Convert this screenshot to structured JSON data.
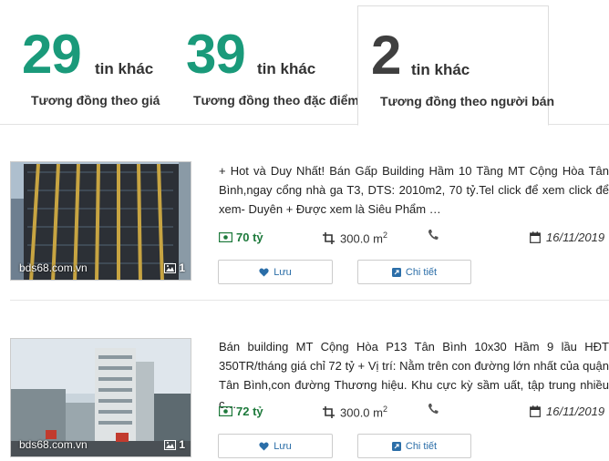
{
  "tabs": [
    {
      "count": "29",
      "more": "tin khác",
      "label": "Tương đồng theo giá"
    },
    {
      "count": "39",
      "more": "tin khác",
      "label": "Tương đồng theo đặc điểm"
    },
    {
      "count": "2",
      "more": "tin khác",
      "label": "Tương đồng theo người bán"
    }
  ],
  "listings": [
    {
      "description": "+ Hot và Duy Nhất! Bán Gấp Building Hầm 10 Tầng MT Cộng Hòa Tân Bình,ngay cổng nhà ga T3, DTS: 2010m2, 70 tỷ.Tel click để xem                click để xem- Duyên + Được xem là Siêu Phẩm …",
      "price": "70 tỷ",
      "area": "300.0 m",
      "area_sup": "2",
      "date": "16/11/2019",
      "site": "bds68.com.vn",
      "photo_count": "1",
      "save_label": "Lưu",
      "detail_label": "Chi tiết"
    },
    {
      "description": "Bán building MT Cộng Hòa P13 Tân Bình 10x30 Hầm 9 lầu HĐT 350TR/tháng giá chỉ 72 tỷ + Vị trí: Nằm trên con đường lớn nhất của quận Tân Bình,con đường Thương hiệu. Khu cực kỳ sầm uất, tập trung nhiều c…",
      "price": "72 tỷ",
      "area": "300.0 m",
      "area_sup": "2",
      "date": "16/11/2019",
      "site": "bds68.com.vn",
      "photo_count": "1",
      "save_label": "Lưu",
      "detail_label": "Chi tiết"
    }
  ],
  "colors": {
    "accent_green": "#1a9a7a",
    "price_green": "#1e7a3c",
    "link_blue": "#2b6ea8"
  },
  "icons": [
    "money-icon",
    "crop-icon",
    "phone-icon",
    "calendar-icon",
    "heart-icon",
    "external-link-icon",
    "image-icon"
  ]
}
